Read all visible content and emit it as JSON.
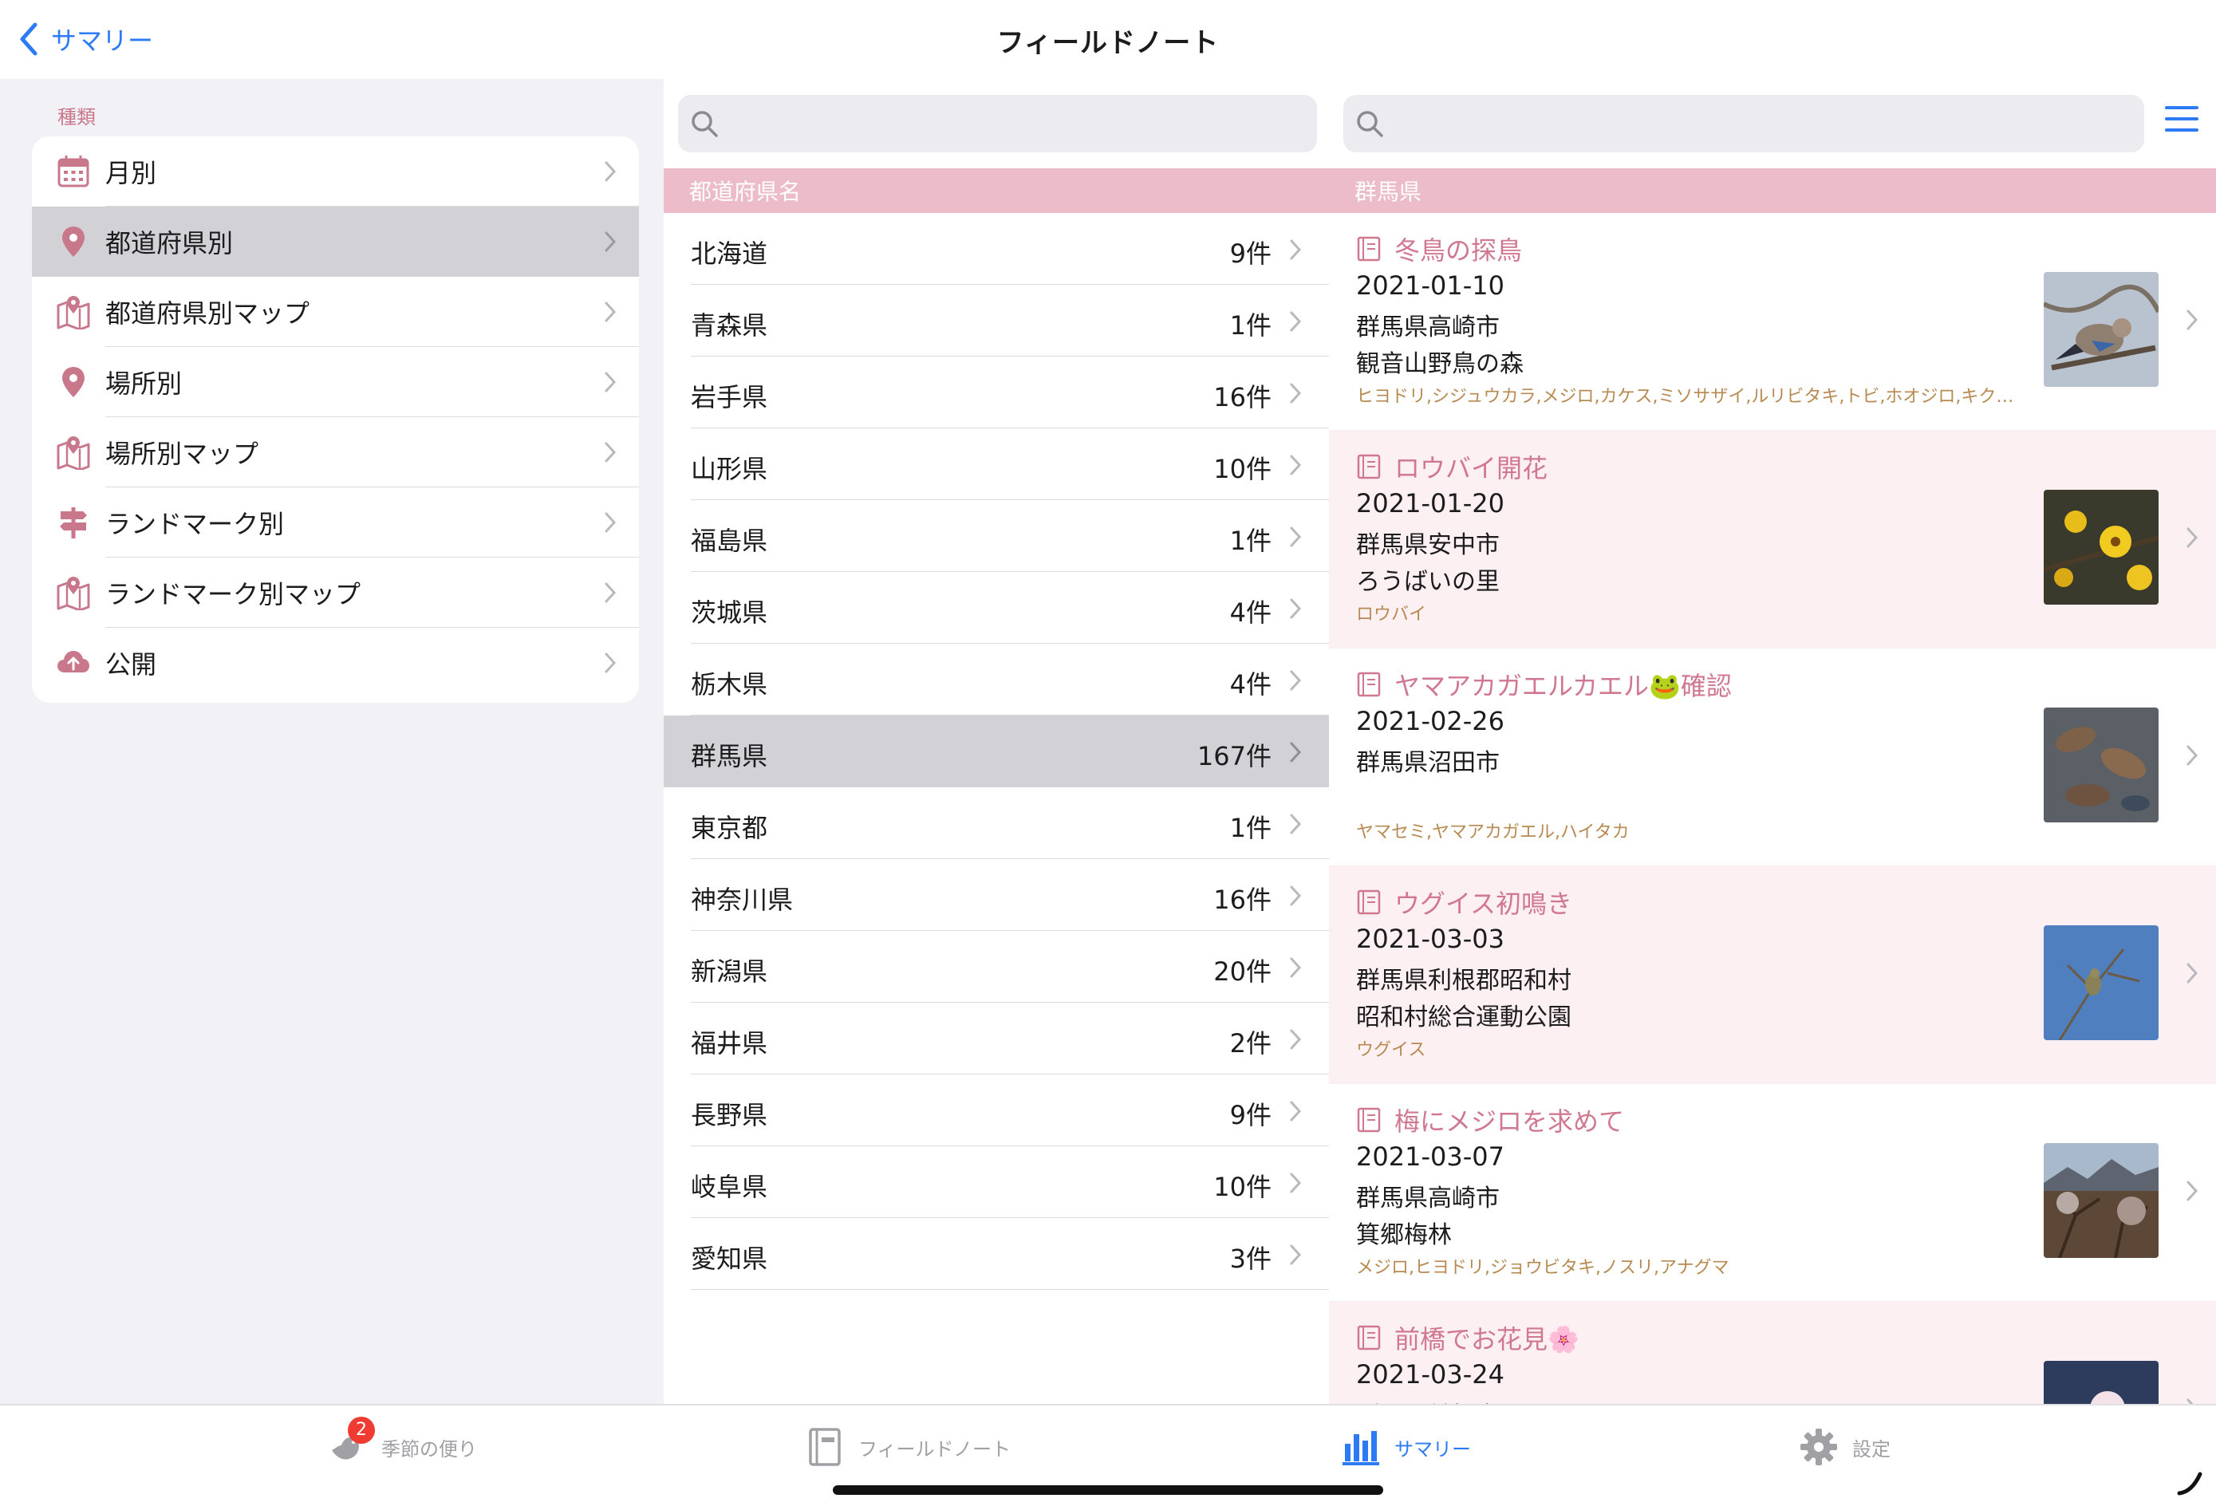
{
  "nav": {
    "back_label": "サマリー",
    "title": "フィールドノート"
  },
  "sidebar": {
    "header": "種類",
    "items": [
      {
        "label": "月別",
        "icon": "calendar-icon",
        "selected": false
      },
      {
        "label": "都道府県別",
        "icon": "location-pin-icon",
        "selected": true
      },
      {
        "label": "都道府県別マップ",
        "icon": "map-icon",
        "selected": false
      },
      {
        "label": "場所別",
        "icon": "location-pin-icon",
        "selected": false
      },
      {
        "label": "場所別マップ",
        "icon": "map-icon",
        "selected": false
      },
      {
        "label": "ランドマーク別",
        "icon": "signpost-icon",
        "selected": false
      },
      {
        "label": "ランドマーク別マップ",
        "icon": "map-icon",
        "selected": false
      },
      {
        "label": "公開",
        "icon": "cloud-upload-icon",
        "selected": false
      }
    ]
  },
  "middle": {
    "search_placeholder": "",
    "section_header": "都道府県名",
    "prefectures": [
      {
        "name": "北海道",
        "count": "9件",
        "selected": false
      },
      {
        "name": "青森県",
        "count": "1件",
        "selected": false
      },
      {
        "name": "岩手県",
        "count": "16件",
        "selected": false
      },
      {
        "name": "山形県",
        "count": "10件",
        "selected": false
      },
      {
        "name": "福島県",
        "count": "1件",
        "selected": false
      },
      {
        "name": "茨城県",
        "count": "4件",
        "selected": false
      },
      {
        "name": "栃木県",
        "count": "4件",
        "selected": false
      },
      {
        "name": "群馬県",
        "count": "167件",
        "selected": true
      },
      {
        "name": "東京都",
        "count": "1件",
        "selected": false
      },
      {
        "name": "神奈川県",
        "count": "16件",
        "selected": false
      },
      {
        "name": "新潟県",
        "count": "20件",
        "selected": false
      },
      {
        "name": "福井県",
        "count": "2件",
        "selected": false
      },
      {
        "name": "長野県",
        "count": "9件",
        "selected": false
      },
      {
        "name": "岐阜県",
        "count": "10件",
        "selected": false
      },
      {
        "name": "愛知県",
        "count": "3件",
        "selected": false
      }
    ]
  },
  "right": {
    "search_placeholder": "",
    "section_header": "群馬県",
    "notes": [
      {
        "title": "冬鳥の探鳥",
        "date": "2021-01-10",
        "city": "群馬県高崎市",
        "place": "観音山野鳥の森",
        "tags": "ヒヨドリ,シジュウカラ,メジロ,カケス,ミソサザイ,ルリビタキ,トビ,ホオジロ,キク…",
        "thumb": "bird-jay-photo"
      },
      {
        "title": "ロウバイ開花",
        "date": "2021-01-20",
        "city": "群馬県安中市",
        "place": "ろうばいの里",
        "tags": "ロウバイ",
        "thumb": "wintersweet-photo"
      },
      {
        "title": "ヤマアカガエルカエル🐸確認",
        "date": "2021-02-26",
        "city": "群馬県沼田市",
        "place": "",
        "tags": "ヤマセミ,ヤマアカガエル,ハイタカ",
        "thumb": "frog-pond-photo"
      },
      {
        "title": "ウグイス初鳴き",
        "date": "2021-03-03",
        "city": "群馬県利根郡昭和村",
        "place": "昭和村総合運動公園",
        "tags": "ウグイス",
        "thumb": "bird-sky-photo"
      },
      {
        "title": "梅にメジロを求めて",
        "date": "2021-03-07",
        "city": "群馬県高崎市",
        "place": "箕郷梅林",
        "tags": "メジロ,ヒヨドリ,ジョウビタキ,ノスリ,アナグマ",
        "thumb": "plum-grove-photo"
      },
      {
        "title": "前橋でお花見🌸",
        "date": "2021-03-24",
        "city": "群馬県前橋市",
        "place": "",
        "tags": "",
        "thumb": "blossom-photo"
      }
    ]
  },
  "tabbar": {
    "tabs": [
      {
        "label": "季節の便り",
        "icon": "bird-icon",
        "active": false,
        "badge": "2"
      },
      {
        "label": "フィールドノート",
        "icon": "notebook-icon",
        "active": false
      },
      {
        "label": "サマリー",
        "icon": "bar-chart-icon",
        "active": true
      },
      {
        "label": "設定",
        "icon": "gear-icon",
        "active": false
      }
    ]
  },
  "colors": {
    "accent_blue": "#2c7bf5",
    "section_pink": "#ecbccb",
    "title_pink": "#d07890",
    "tag_brown": "#b78a52",
    "badge_red": "#ef3b32"
  }
}
